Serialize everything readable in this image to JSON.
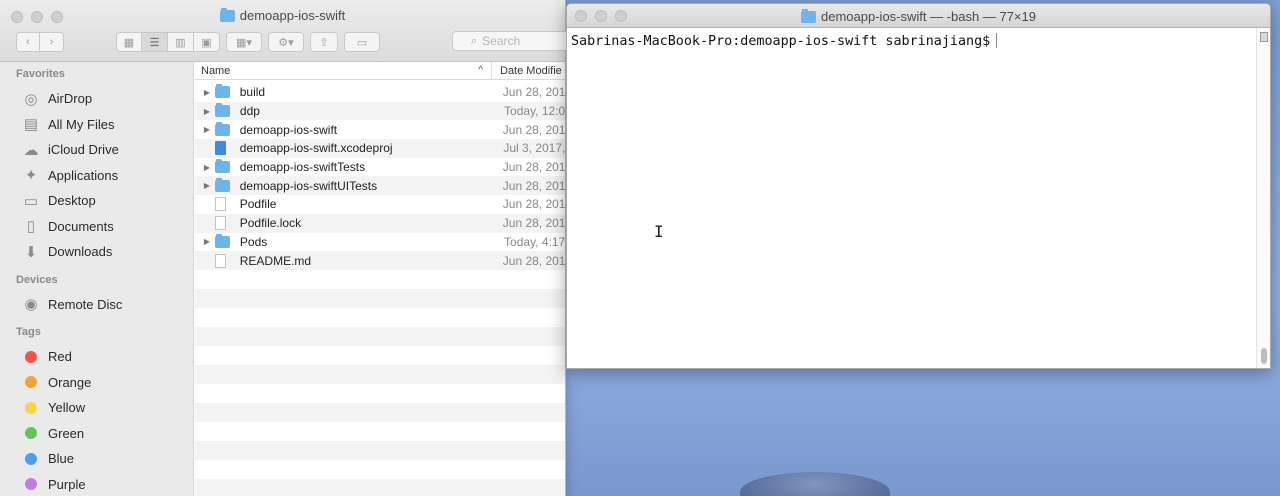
{
  "finder": {
    "title": "demoapp-ios-swift",
    "search_placeholder": "Search",
    "sidebar": {
      "favorites_label": "Favorites",
      "favorites": [
        {
          "label": "AirDrop",
          "icon": "airdrop-icon",
          "glyph": "◎"
        },
        {
          "label": "All My Files",
          "icon": "all-files-icon",
          "glyph": "▤"
        },
        {
          "label": "iCloud Drive",
          "icon": "cloud-icon",
          "glyph": "☁"
        },
        {
          "label": "Applications",
          "icon": "applications-icon",
          "glyph": "✦"
        },
        {
          "label": "Desktop",
          "icon": "desktop-icon",
          "glyph": "▭"
        },
        {
          "label": "Documents",
          "icon": "documents-icon",
          "glyph": "▯"
        },
        {
          "label": "Downloads",
          "icon": "downloads-icon",
          "glyph": "⬇"
        }
      ],
      "devices_label": "Devices",
      "devices": [
        {
          "label": "Remote Disc",
          "icon": "disc-icon",
          "glyph": "◉"
        }
      ],
      "tags_label": "Tags",
      "tags": [
        {
          "label": "Red",
          "color": "#f2544c"
        },
        {
          "label": "Orange",
          "color": "#f4a13c"
        },
        {
          "label": "Yellow",
          "color": "#f5d54a"
        },
        {
          "label": "Green",
          "color": "#62c554"
        },
        {
          "label": "Blue",
          "color": "#4a9ff0"
        },
        {
          "label": "Purple",
          "color": "#c27be0"
        }
      ]
    },
    "columns": {
      "name": "Name",
      "date": "Date Modifie"
    },
    "files": [
      {
        "name": "build",
        "date": "Jun 28, 201",
        "kind": "folder",
        "expandable": true
      },
      {
        "name": "ddp",
        "date": "Today, 12:0",
        "kind": "folder",
        "expandable": true
      },
      {
        "name": "demoapp-ios-swift",
        "date": "Jun 28, 201",
        "kind": "folder",
        "expandable": true
      },
      {
        "name": "demoapp-ios-swift.xcodeproj",
        "date": "Jul 3, 2017,",
        "kind": "project",
        "expandable": false
      },
      {
        "name": "demoapp-ios-swiftTests",
        "date": "Jun 28, 201",
        "kind": "folder",
        "expandable": true
      },
      {
        "name": "demoapp-ios-swiftUITests",
        "date": "Jun 28, 201",
        "kind": "folder",
        "expandable": true
      },
      {
        "name": "Podfile",
        "date": "Jun 28, 201",
        "kind": "doc",
        "expandable": false
      },
      {
        "name": "Podfile.lock",
        "date": "Jun 28, 201",
        "kind": "doc",
        "expandable": false
      },
      {
        "name": "Pods",
        "date": "Today, 4:17",
        "kind": "folder",
        "expandable": true
      },
      {
        "name": "README.md",
        "date": "Jun 28, 201",
        "kind": "doc",
        "expandable": false
      }
    ]
  },
  "terminal": {
    "title": "demoapp-ios-swift — -bash — 77×19",
    "prompt": "Sabrinas-MacBook-Pro:demoapp-ios-swift sabrinajiang$"
  }
}
